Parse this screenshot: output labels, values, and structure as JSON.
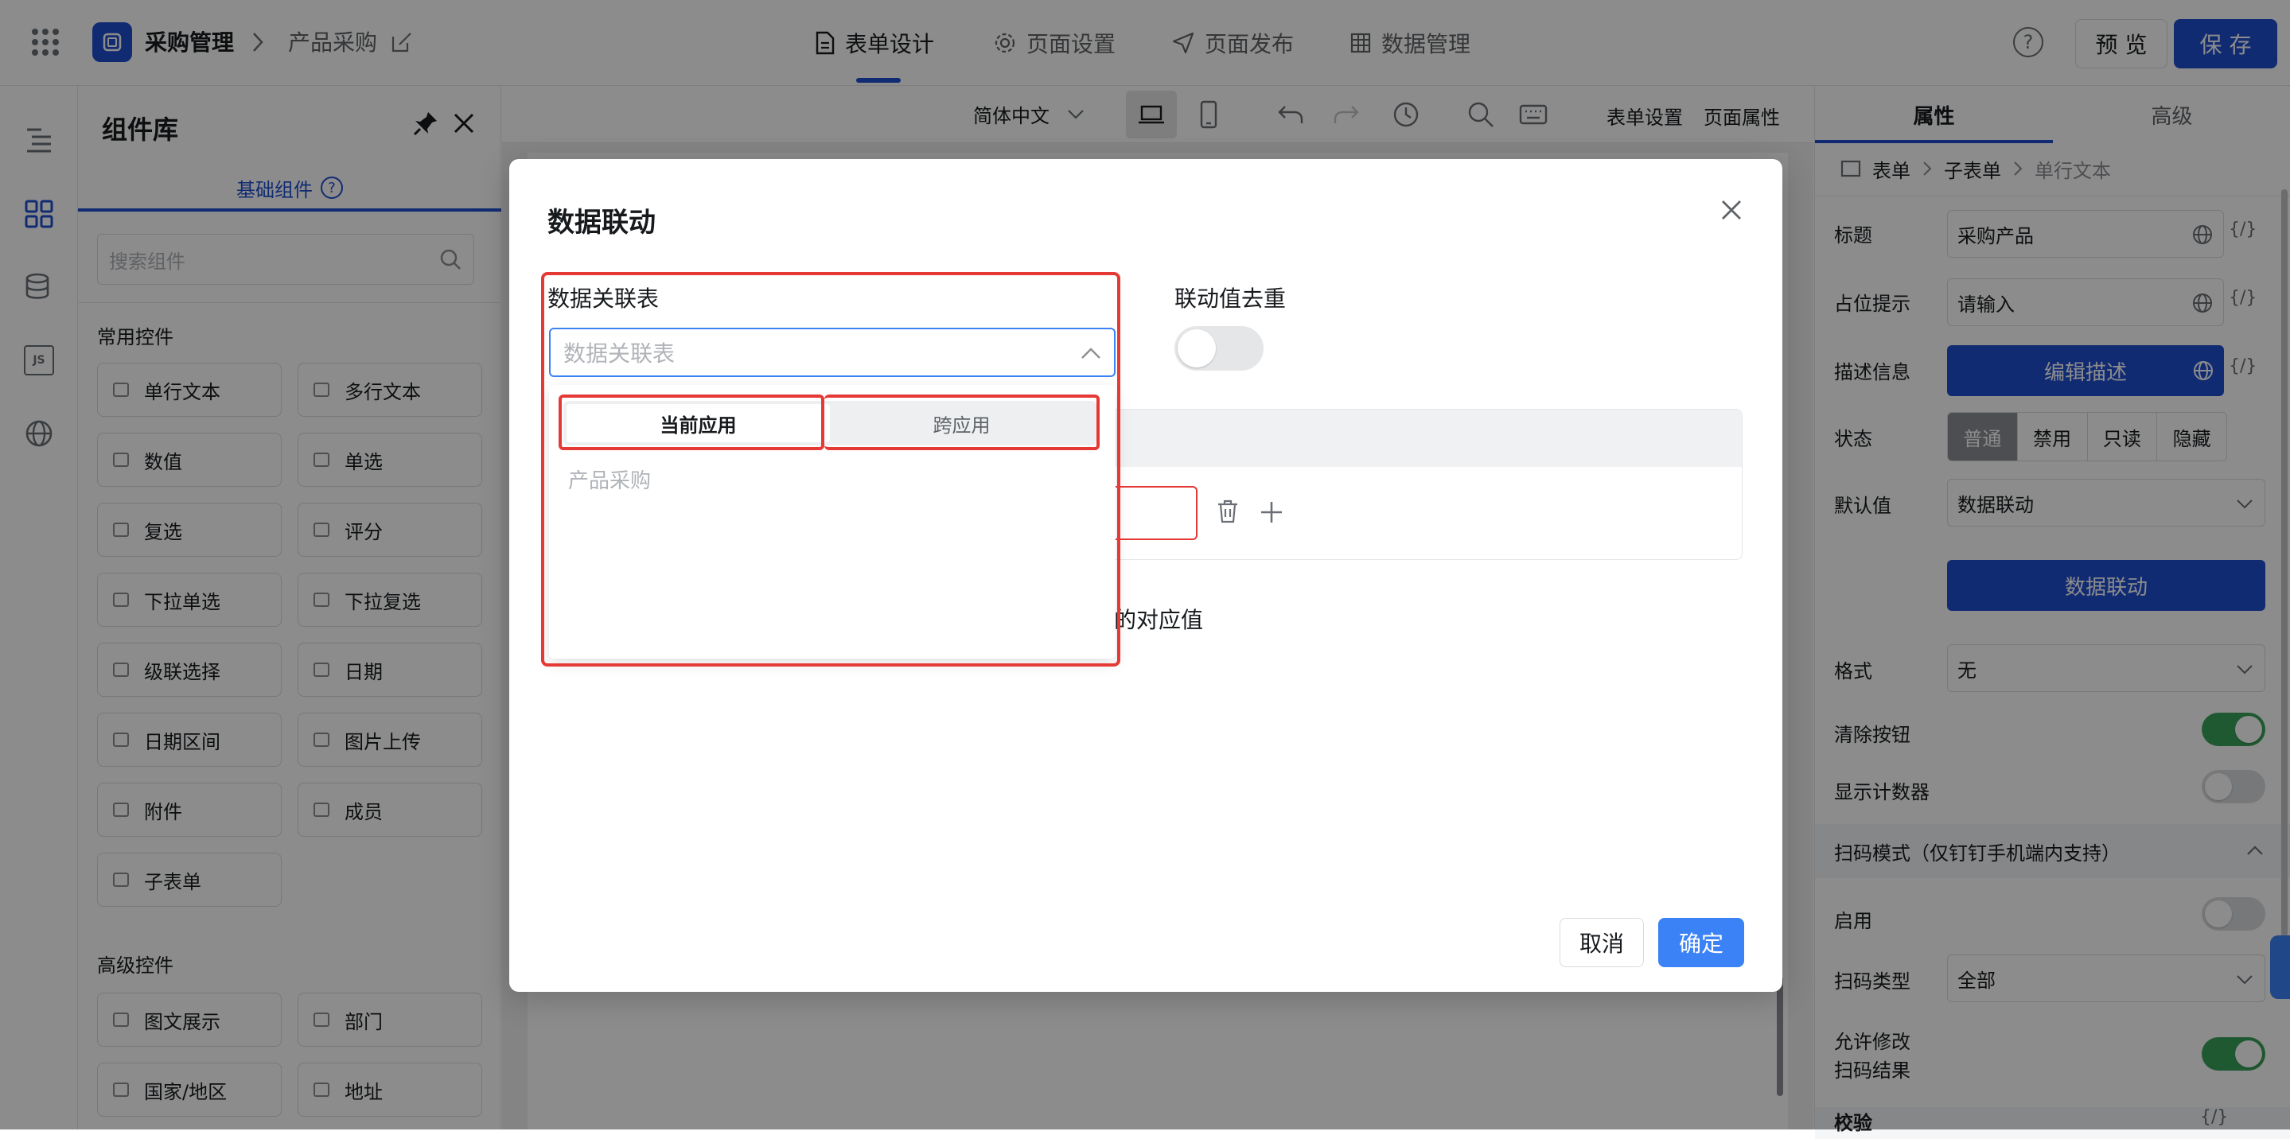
{
  "topbar": {
    "app_name": "采购管理",
    "page_name": "产品采购",
    "nav": [
      {
        "label": "表单设计",
        "icon": "document-icon",
        "active": true
      },
      {
        "label": "页面设置",
        "icon": "gear-icon",
        "active": false
      },
      {
        "label": "页面发布",
        "icon": "send-icon",
        "active": false
      },
      {
        "label": "数据管理",
        "icon": "grid-icon",
        "active": false
      }
    ],
    "preview_label": "预 览",
    "save_label": "保 存"
  },
  "component_library": {
    "title": "组件库",
    "tab_label": "基础组件",
    "search_placeholder": "搜索组件",
    "common_title": "常用控件",
    "common": [
      {
        "label": "单行文本",
        "icon": "input-icon"
      },
      {
        "label": "多行文本",
        "icon": "textarea-icon"
      },
      {
        "label": "数值",
        "icon": "number-icon"
      },
      {
        "label": "单选",
        "icon": "radio-icon"
      },
      {
        "label": "复选",
        "icon": "checkbox-icon"
      },
      {
        "label": "评分",
        "icon": "star-icon"
      },
      {
        "label": "下拉单选",
        "icon": "dropdown-icon"
      },
      {
        "label": "下拉复选",
        "icon": "multi-dropdown-icon"
      },
      {
        "label": "级联选择",
        "icon": "cascade-icon"
      },
      {
        "label": "日期",
        "icon": "calendar-icon"
      },
      {
        "label": "日期区间",
        "icon": "date-range-icon"
      },
      {
        "label": "图片上传",
        "icon": "image-icon"
      },
      {
        "label": "附件",
        "icon": "paperclip-icon"
      },
      {
        "label": "成员",
        "icon": "user-icon"
      },
      {
        "label": "子表单",
        "icon": "subform-icon"
      }
    ],
    "advanced_title": "高级控件",
    "advanced": [
      {
        "label": "图文展示",
        "icon": "rich-text-icon"
      },
      {
        "label": "部门",
        "icon": "department-icon"
      },
      {
        "label": "国家/地区",
        "icon": "globe-icon"
      },
      {
        "label": "地址",
        "icon": "location-icon"
      }
    ]
  },
  "canvas_toolbar": {
    "language": "简体中文",
    "form_settings": "表单设置",
    "page_props": "页面属性"
  },
  "right_panel": {
    "tabs": [
      "属性",
      "高级"
    ],
    "breadcrumb": [
      "表单",
      "子表单",
      "单行文本"
    ],
    "title_label": "标题",
    "title_value": "采购产品",
    "placeholder_label": "占位提示",
    "placeholder_value": "请输入",
    "desc_label": "描述信息",
    "desc_button": "编辑描述",
    "state_label": "状态",
    "state_options": [
      "普通",
      "禁用",
      "只读",
      "隐藏"
    ],
    "default_label": "默认值",
    "default_value": "数据联动",
    "linkage_button": "数据联动",
    "format_label": "格式",
    "format_value": "无",
    "clear_label": "清除按钮",
    "counter_label": "显示计数器",
    "scan_section": "扫码模式（仅钉钉手机端内支持）",
    "enable_label": "启用",
    "scan_type_label": "扫码类型",
    "scan_type_value": "全部",
    "allow_edit_label_1": "允许修改",
    "allow_edit_label_2": "扫码结果",
    "validate_label": "校验",
    "code_icon_text": "{/}",
    "colors": {
      "primary": "#1f4fd1",
      "toggle_on": "#3aa35a"
    }
  },
  "modal": {
    "title": "数据联动",
    "table_label": "数据关联表",
    "table_placeholder": "数据关联表",
    "dedupe_label": "联动值去重",
    "dropdown_tabs": [
      "当前应用",
      "跨应用"
    ],
    "dropdown_option": "产品采购",
    "partial_text": "的对应值",
    "cancel_label": "取消",
    "confirm_label": "确定",
    "colors": {
      "highlight": "#e53935",
      "confirm": "#3b82f6"
    }
  }
}
